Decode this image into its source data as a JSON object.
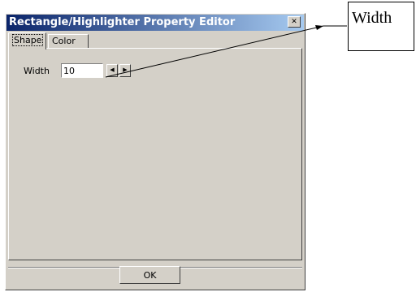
{
  "window": {
    "title": "Rectangle/Highlighter Property Editor",
    "close_glyph": "✕"
  },
  "tabs": [
    {
      "label": "Shape",
      "active": true
    },
    {
      "label": "Color",
      "active": false
    }
  ],
  "shape": {
    "width_label": "Width",
    "width_value": "10",
    "spin_left": "◀",
    "spin_right": "▶"
  },
  "footer": {
    "ok_label": "OK"
  },
  "callout": {
    "text": "Width"
  },
  "colors": {
    "titlebar_start": "#0a246a",
    "titlebar_end": "#a6caf0",
    "dialog_bg": "#d4d0c8"
  }
}
